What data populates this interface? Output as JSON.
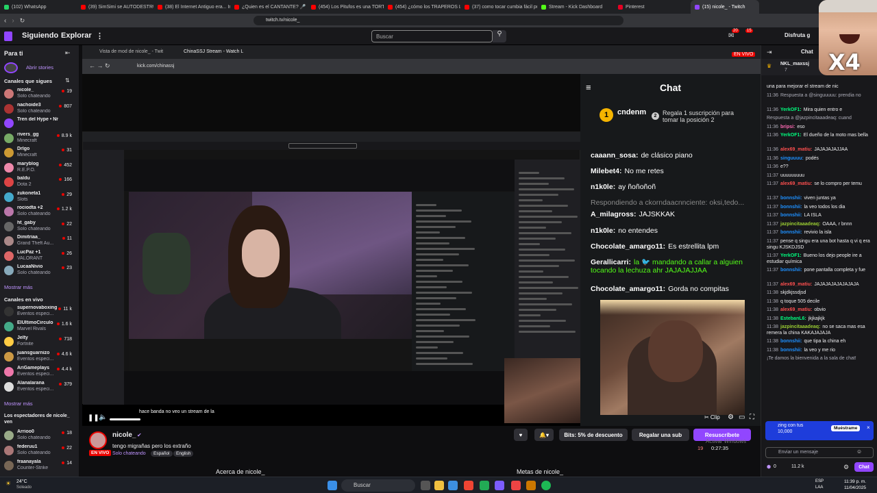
{
  "browser": {
    "tabs": [
      {
        "label": "(102) WhatsApp",
        "color": "#25d366"
      },
      {
        "label": "(39) SimSimi se AUTODESTRUYÓ",
        "color": "#ff0000"
      },
      {
        "label": "(38) El Internet Antiguo era... Inq",
        "color": "#ff0000"
      },
      {
        "label": "¿Quien es el CANTANTE? 🎤 Jueg",
        "color": "#ff0000"
      },
      {
        "label": "(454) Los Pitufos es una TORTURA",
        "color": "#ff0000"
      },
      {
        "label": "(454) ¿cómo los TRAPEROS LOGR",
        "color": "#ff0000"
      },
      {
        "label": "(37) como tocar cumbia fácil puer",
        "color": "#ff0000"
      },
      {
        "label": "Stream - Kick Dashboard",
        "color": "#53fc18"
      },
      {
        "label": "Pinterest",
        "color": "#e60023"
      },
      {
        "label": "(15) nicole_ - Twitch",
        "color": "#9146ff"
      }
    ],
    "url": "twitch.tv/nicole_"
  },
  "twitch_nav": {
    "following": "Siguiendo",
    "browse": "Explorar",
    "search_placeholder": "Buscar",
    "badge_notifications": "20",
    "badge_messages": "15",
    "prime_label": "Disfruta g"
  },
  "sidebar": {
    "for_you": "Para ti",
    "open_stories": "Abrir stories",
    "followed_heading": "Canales que sigues",
    "followed": [
      {
        "name": "nicole_",
        "game": "Solo chateando",
        "viewers": "19",
        "color": "#c77"
      },
      {
        "name": "nachoide3",
        "game": "Solo chateando",
        "viewers": "807",
        "color": "#a33"
      },
      {
        "name": "Tren del Hype • Nive",
        "game": "",
        "viewers": "",
        "color": "#9146ff"
      },
      {
        "name": "rivers_gg",
        "game": "Minecraft",
        "viewers": "8.9 k",
        "color": "#7a6"
      },
      {
        "name": "Drlgo",
        "game": "Minecraft",
        "viewers": "31",
        "color": "#c93"
      },
      {
        "name": "maryblog",
        "game": "R.E.P.O.",
        "viewers": "452",
        "color": "#e8a"
      },
      {
        "name": "baldu",
        "game": "Dota 2",
        "viewers": "166",
        "color": "#d44"
      },
      {
        "name": "zukoneta1",
        "game": "Slots",
        "viewers": "29",
        "color": "#4ac"
      },
      {
        "name": "rociodta +2",
        "game": "Solo chateando",
        "viewers": "1.2 k",
        "color": "#b7a"
      },
      {
        "name": "ht_gaby",
        "game": "Solo chateando",
        "viewers": "22",
        "color": "#666"
      },
      {
        "name": "Dimitriaa_",
        "game": "Grand Theft Au...",
        "viewers": "11",
        "color": "#a88"
      },
      {
        "name": "LucPaz +1",
        "game": "VALORANT",
        "viewers": "26",
        "color": "#d66"
      },
      {
        "name": "LucaaNivio",
        "game": "Solo chateando",
        "viewers": "23",
        "color": "#8ab"
      }
    ],
    "show_more_1": "Mostrar más",
    "live_heading": "Canales en vivo",
    "live": [
      {
        "name": "supernovaboxing",
        "game": "Eventos especi...",
        "viewers": "11 k",
        "color": "#333"
      },
      {
        "name": "ElUltimoCirculo",
        "game": "Marvel Rivals",
        "viewers": "1.6 k",
        "color": "#4a8"
      },
      {
        "name": "Jelty",
        "game": "Fortnite",
        "viewers": "718",
        "color": "#fc4"
      },
      {
        "name": "juansguarnizo",
        "game": "Eventos especi...",
        "viewers": "4.6 k",
        "color": "#c94"
      },
      {
        "name": "AriGameplays",
        "game": "Eventos especi...",
        "viewers": "4.4 k",
        "color": "#e7a"
      },
      {
        "name": "Alanalarana",
        "game": "Eventos especi...",
        "viewers": "379",
        "color": "#ddd"
      }
    ],
    "show_more_2": "Mostrar más",
    "viewers_heading": "Los espectadores de nicole_ ven",
    "viewers_list": [
      {
        "name": "Arrioo0",
        "game": "Solo chateando",
        "viewers": "18",
        "color": "#9a8"
      },
      {
        "name": "federuu1",
        "game": "Solo chateando",
        "viewers": "22",
        "color": "#a77"
      },
      {
        "name": "fraanayala",
        "game": "Counter-Strike",
        "viewers": "14",
        "color": "#765"
      }
    ]
  },
  "inner_browser": {
    "tab1": "Vista de mod de nicole_ - Twit",
    "tab2": "ChinaSSJ Stream - Watch L",
    "url": "kick.com/chinassj",
    "live_badge": "EN VIVO"
  },
  "kick_chat": {
    "title": "Chat",
    "top_user": "cndenm",
    "top_count": "1",
    "gift_rank": "2",
    "gift_text": "Regala 1 suscripción para tomar la posición 2",
    "messages": [
      {
        "user": "caaann_sosa:",
        "text": "de clásico piano",
        "color": "#ffffff"
      },
      {
        "user": "Milebet4:",
        "text": "No me retes",
        "color": "#ffffff"
      },
      {
        "user": "n1k0le:",
        "text": "ay ñoñoñoñ",
        "color": "#ffffff"
      },
      {
        "user": "",
        "text": "Respondiendo a ckorndaacnnciente: oksi,tedo...",
        "color": "#8a8a8a"
      },
      {
        "user": "A_milagross:",
        "text": "JAJSKKAK",
        "color": "#ffffff"
      },
      {
        "user": "n1k0le:",
        "text": "no entendes",
        "color": "#ffffff"
      },
      {
        "user": "Chocolate_amargo11:",
        "text": "Es estrellita lpm",
        "color": "#ffffff"
      },
      {
        "user": "Gerallicarri:",
        "text": "la 🐦 mandando a callar a alguien tocando la lechuza ahr JAJAJAJJAA",
        "color": "#53fc18"
      },
      {
        "user": "Chocolate_amargo11:",
        "text": "Gorda no compitas",
        "color": "#ffffff"
      }
    ]
  },
  "player": {
    "overlay_text": "hace banda no veo un stream de la"
  },
  "channel": {
    "name": "nicole_",
    "title": "tengo migrañas pero los extraño",
    "live": "EN VIVO",
    "category": "Solo chateando",
    "tags": [
      "Español",
      "English"
    ],
    "bits": "Bits: 5% de descuento",
    "gift_sub": "Regalar una sub",
    "resub": "Resuscríbete",
    "viewers": "19",
    "uptime": "0:27:35",
    "about": "Acerca de nicole_",
    "goals": "Metas de nicole_",
    "watermark": "Activar Windows",
    "watermark_sub": "Ve a Configuración para activar Windows."
  },
  "twitch_chat": {
    "title": "Chat",
    "top_user": "NKL_maxssj",
    "top_count": "7",
    "messages": [
      {
        "time": "",
        "user": "",
        "text": "una para mejorar el stream de nic",
        "color": "#efeff1"
      },
      {
        "time": "11:36",
        "user": "",
        "text": "Respuesta a @singuuuuu: prendia no",
        "color": "#adadb8"
      },
      {
        "time": "11:36",
        "user": "YerkOF1:",
        "text": "Mira quien entro e",
        "color": "#00ff7f"
      },
      {
        "time": "",
        "user": "",
        "text": "Respuesta a @jazpincitaaadeaq: cuand",
        "color": "#adadb8"
      },
      {
        "time": "11:36",
        "user": "bripsi:",
        "text": "eso",
        "color": "#ff69b4"
      },
      {
        "time": "11:36",
        "user": "YerkOF1:",
        "text": "El dueño de la moto mas bella",
        "color": "#00ff7f"
      },
      {
        "time": "11:36",
        "user": "alex69_matiu:",
        "text": "JAJAJAJAJJAA",
        "color": "#ff4f4f"
      },
      {
        "time": "11:36",
        "user": "singuuuu:",
        "text": "podés",
        "color": "#1e90ff"
      },
      {
        "time": "11:36",
        "user": "",
        "text": "e??",
        "color": "#efeff1"
      },
      {
        "time": "11:37",
        "user": "",
        "text": "uuuuuuuuu",
        "color": "#efeff1"
      },
      {
        "time": "11:37",
        "user": "alex69_matiu:",
        "text": "se lo compro per temu",
        "color": "#ff4f4f"
      },
      {
        "time": "11:37",
        "user": "bonnshii:",
        "text": "viven juntas ya",
        "color": "#1e90ff"
      },
      {
        "time": "11:37",
        "user": "bonnshii:",
        "text": "la veo todos los dia",
        "color": "#1e90ff"
      },
      {
        "time": "11:37",
        "user": "bonnshii:",
        "text": "LA ISLA",
        "color": "#1e90ff"
      },
      {
        "time": "11:37",
        "user": "jazpincitaaadeaq:",
        "text": "OAAA, r bnnn",
        "color": "#9acd32"
      },
      {
        "time": "11:37",
        "user": "bonnshii:",
        "text": "revivio la isla",
        "color": "#1e90ff"
      },
      {
        "time": "11:37",
        "user": "",
        "text": "pense q singu era una bot hasta q vi q era singu KJSKDJSD",
        "color": "#efeff1"
      },
      {
        "time": "11:37",
        "user": "YerkOF1:",
        "text": "Bueno los dejo people ire a estudiar química",
        "color": "#00ff7f"
      },
      {
        "time": "11:37",
        "user": "bonnshii:",
        "text": "pone pantalla completa y fue",
        "color": "#1e90ff"
      },
      {
        "time": "11:37",
        "user": "alex69_matiu:",
        "text": "JAJAJAJAJAJAJAJA",
        "color": "#ff4f4f"
      },
      {
        "time": "11:38",
        "user": "",
        "text": "skjdkjssdjsd",
        "color": "#efeff1"
      },
      {
        "time": "11:38",
        "user": "",
        "text": "q toque 505 decile",
        "color": "#efeff1"
      },
      {
        "time": "11:38",
        "user": "alex69_matiu:",
        "text": "obvio",
        "color": "#ff4f4f"
      },
      {
        "time": "11:38",
        "user": "EstebanL6:",
        "text": "jkjkajkjk",
        "color": "#00ff7f"
      },
      {
        "time": "11:38",
        "user": "jazpincitaaadeaq:",
        "text": "no se saca mas esa remera la china KAKAJAJAJA",
        "color": "#9acd32"
      },
      {
        "time": "11:38",
        "user": "bonnshii:",
        "text": "que tipa la china eh",
        "color": "#1e90ff"
      },
      {
        "time": "11:38",
        "user": "bonnshii:",
        "text": "la veo y me rio",
        "color": "#1e90ff"
      },
      {
        "time": "",
        "user": "",
        "text": "¡Te damos la bienvenida a la sala de chat!",
        "color": "#adadb8"
      }
    ],
    "promo_user": "zing con tus",
    "promo_amount": "10,000",
    "promo_button": "Muéstrame",
    "input_placeholder": "Enviar un mensaje",
    "points": "0",
    "points2": "11.2 k",
    "chat_button": "Chat"
  },
  "taskbar": {
    "weather_temp": "24°C",
    "weather_desc": "Soleado",
    "search": "Buscar",
    "lang1": "ESP",
    "lang2": "LAA",
    "time": "11:39 p. m.",
    "date": "11/04/2025"
  },
  "meme_overlay": "X4",
  "colors": {
    "twitch_purple": "#9146ff",
    "kick_green": "#53fc18",
    "live_red": "#eb0400"
  }
}
